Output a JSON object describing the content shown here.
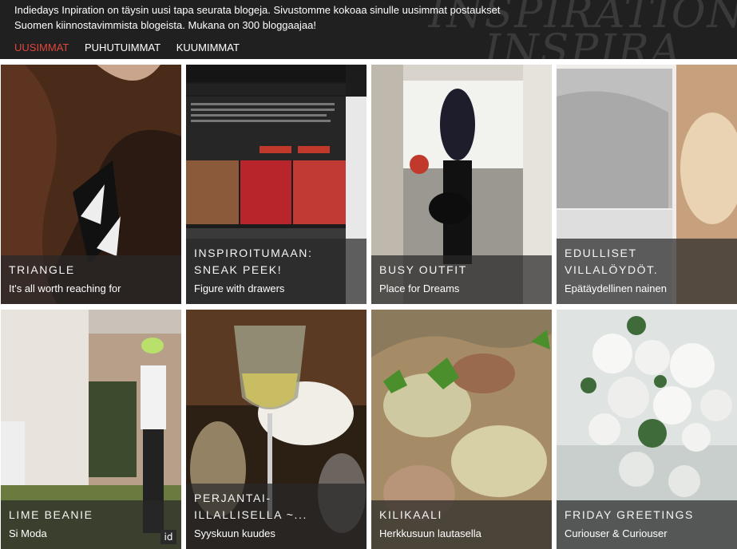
{
  "header": {
    "intro_line1": "Indiedays Inpiration on täysin uusi tapa seurata blogeja. Sivustomme kokoaa sinulle uusimmat postaukset",
    "intro_line2": "Suomen kiinnostavimmista blogeista. Mukana on 300 bloggaajaa!",
    "watermark": "INSPIRATION",
    "watermark2": "INSPIRA",
    "accent_color": "#e0473b",
    "tabs": [
      {
        "label": "UUSIMMAT",
        "active": true
      },
      {
        "label": "PUHUTUIMMAT",
        "active": false
      },
      {
        "label": "KUUMIMMAT",
        "active": false
      }
    ]
  },
  "posts": [
    {
      "title": "TRIANGLE",
      "subtitle": "It's all worth reaching for"
    },
    {
      "title": "INSPIROITUMAAN: SNEAK PEEK!",
      "subtitle": "Figure with drawers"
    },
    {
      "title": "BUSY OUTFIT",
      "subtitle": "Place for Dreams"
    },
    {
      "title": "EDULLISET VILLALÖYDÖT.",
      "subtitle": "Epätäydellinen nainen"
    },
    {
      "title": "LIME BEANIE",
      "subtitle": "Si Moda",
      "badge": "id"
    },
    {
      "title": "PERJANTAI-ILLALLISELLA ~...",
      "subtitle": "Syyskuun kuudes"
    },
    {
      "title": "KILIKAALI",
      "subtitle": "Herkkusuun lautasella"
    },
    {
      "title": "FRIDAY GREETINGS",
      "subtitle": "Curiouser & Curiouser"
    }
  ]
}
